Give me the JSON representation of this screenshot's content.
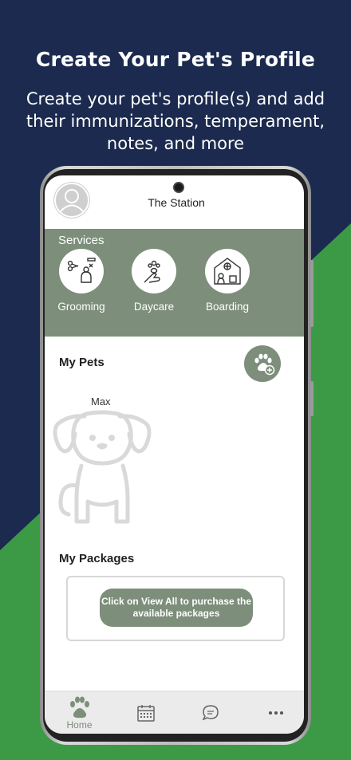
{
  "promo": {
    "headline": "Create Your Pet's Profile",
    "subline": "Create your pet's profile(s) and add their immunizations, temperament, notes, and more"
  },
  "header": {
    "business_name": "The Station",
    "avatar_icon": "user-avatar-icon"
  },
  "services": {
    "title": "Services",
    "items": [
      {
        "label": "Grooming",
        "icon": "grooming-icon"
      },
      {
        "label": "Daycare",
        "icon": "daycare-icon"
      },
      {
        "label": "Boarding",
        "icon": "boarding-icon"
      }
    ]
  },
  "pets": {
    "title": "My Pets",
    "add_icon": "add-pet-paw-icon",
    "items": [
      {
        "name": "Max",
        "icon": "dog-outline-icon"
      }
    ]
  },
  "packages": {
    "title": "My Packages",
    "cta": "Click on View All to purchase the available packages"
  },
  "nav": {
    "items": [
      {
        "label": "Home",
        "icon": "paw-icon",
        "active": true
      },
      {
        "label": "",
        "icon": "calendar-icon"
      },
      {
        "label": "",
        "icon": "chat-icon"
      },
      {
        "label": "",
        "icon": "more-icon"
      }
    ]
  },
  "colors": {
    "navy": "#1b2a4e",
    "green": "#3c9a47",
    "sage": "#7d8e7b"
  }
}
